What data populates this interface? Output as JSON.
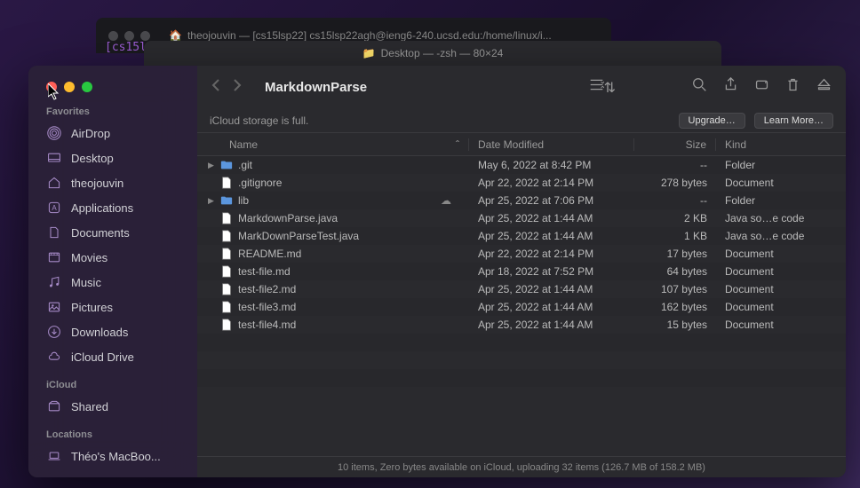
{
  "background_terminals": {
    "t1_title": "theojouvin — [cs15lsp22]  cs15lsp22agh@ieng6-240.ucsd.edu:/home/linux/i...",
    "t1_body": "[cs15l",
    "t2_title": "Desktop — -zsh — 80×24"
  },
  "sidebar": {
    "sections": {
      "favorites_label": "Favorites",
      "icloud_label": "iCloud",
      "locations_label": "Locations"
    },
    "favorites": [
      {
        "label": "AirDrop",
        "icon": "airdrop"
      },
      {
        "label": "Desktop",
        "icon": "desktop"
      },
      {
        "label": "theojouvin",
        "icon": "home"
      },
      {
        "label": "Applications",
        "icon": "apps"
      },
      {
        "label": "Documents",
        "icon": "documents"
      },
      {
        "label": "Movies",
        "icon": "movies"
      },
      {
        "label": "Music",
        "icon": "music"
      },
      {
        "label": "Pictures",
        "icon": "pictures"
      },
      {
        "label": "Downloads",
        "icon": "downloads"
      },
      {
        "label": "iCloud Drive",
        "icon": "cloud"
      }
    ],
    "icloud": [
      {
        "label": "Shared",
        "icon": "shared"
      }
    ],
    "locations": [
      {
        "label": "Théo's MacBoo...",
        "icon": "laptop"
      }
    ]
  },
  "toolbar": {
    "folder_title": "MarkdownParse",
    "view_icon": "list-view",
    "actions": [
      "search",
      "share",
      "tags",
      "trash",
      "eject"
    ]
  },
  "banner": {
    "text": "iCloud storage is full.",
    "upgrade": "Upgrade…",
    "learn": "Learn More…"
  },
  "columns": {
    "name": "Name",
    "date": "Date Modified",
    "size": "Size",
    "kind": "Kind"
  },
  "files": [
    {
      "name": ".git",
      "date": "May 6, 2022 at 8:42 PM",
      "size": "--",
      "kind": "Folder",
      "type": "folder",
      "expandable": true
    },
    {
      "name": ".gitignore",
      "date": "Apr 22, 2022 at 2:14 PM",
      "size": "278 bytes",
      "kind": "Document",
      "type": "doc"
    },
    {
      "name": "lib",
      "date": "Apr 25, 2022 at 7:06 PM",
      "size": "--",
      "kind": "Folder",
      "type": "folder",
      "expandable": true,
      "cloud": true
    },
    {
      "name": "MarkdownParse.java",
      "date": "Apr 25, 2022 at 1:44 AM",
      "size": "2 KB",
      "kind": "Java so…e code",
      "type": "doc"
    },
    {
      "name": "MarkDownParseTest.java",
      "date": "Apr 25, 2022 at 1:44 AM",
      "size": "1 KB",
      "kind": "Java so…e code",
      "type": "doc"
    },
    {
      "name": "README.md",
      "date": "Apr 22, 2022 at 2:14 PM",
      "size": "17 bytes",
      "kind": "Document",
      "type": "doc"
    },
    {
      "name": "test-file.md",
      "date": "Apr 18, 2022 at 7:52 PM",
      "size": "64 bytes",
      "kind": "Document",
      "type": "doc"
    },
    {
      "name": "test-file2.md",
      "date": "Apr 25, 2022 at 1:44 AM",
      "size": "107 bytes",
      "kind": "Document",
      "type": "doc"
    },
    {
      "name": "test-file3.md",
      "date": "Apr 25, 2022 at 1:44 AM",
      "size": "162 bytes",
      "kind": "Document",
      "type": "doc"
    },
    {
      "name": "test-file4.md",
      "date": "Apr 25, 2022 at 1:44 AM",
      "size": "15 bytes",
      "kind": "Document",
      "type": "doc"
    }
  ],
  "status": "10 items, Zero bytes available on iCloud, uploading 32 items (126.7 MB of 158.2 MB)"
}
